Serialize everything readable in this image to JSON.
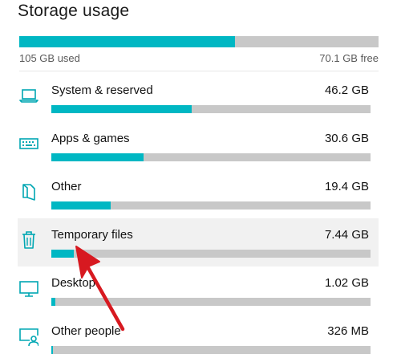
{
  "header": {
    "title": "Storage usage"
  },
  "overall": {
    "used_label": "105 GB used",
    "free_label": "70.1 GB free",
    "used_fraction": 0.6
  },
  "colors": {
    "accent": "#00b7c3",
    "track": "#c8c8c8",
    "highlight": "#f1f1f1",
    "annotation_arrow": "#d71920"
  },
  "categories": [
    {
      "name": "System & reserved",
      "size": "46.2 GB",
      "fraction": 0.44,
      "icon": "laptop-icon"
    },
    {
      "name": "Apps & games",
      "size": "30.6 GB",
      "fraction": 0.29,
      "icon": "keyboard-icon"
    },
    {
      "name": "Other",
      "size": "19.4 GB",
      "fraction": 0.185,
      "icon": "document-icon"
    },
    {
      "name": "Temporary files",
      "size": "7.44 GB",
      "fraction": 0.07,
      "icon": "trash-icon",
      "highlighted": true
    },
    {
      "name": "Desktop",
      "size": "1.02 GB",
      "fraction": 0.012,
      "icon": "monitor-icon"
    },
    {
      "name": "Other people",
      "size": "326 MB",
      "fraction": 0.006,
      "icon": "user-monitor-icon"
    }
  ]
}
